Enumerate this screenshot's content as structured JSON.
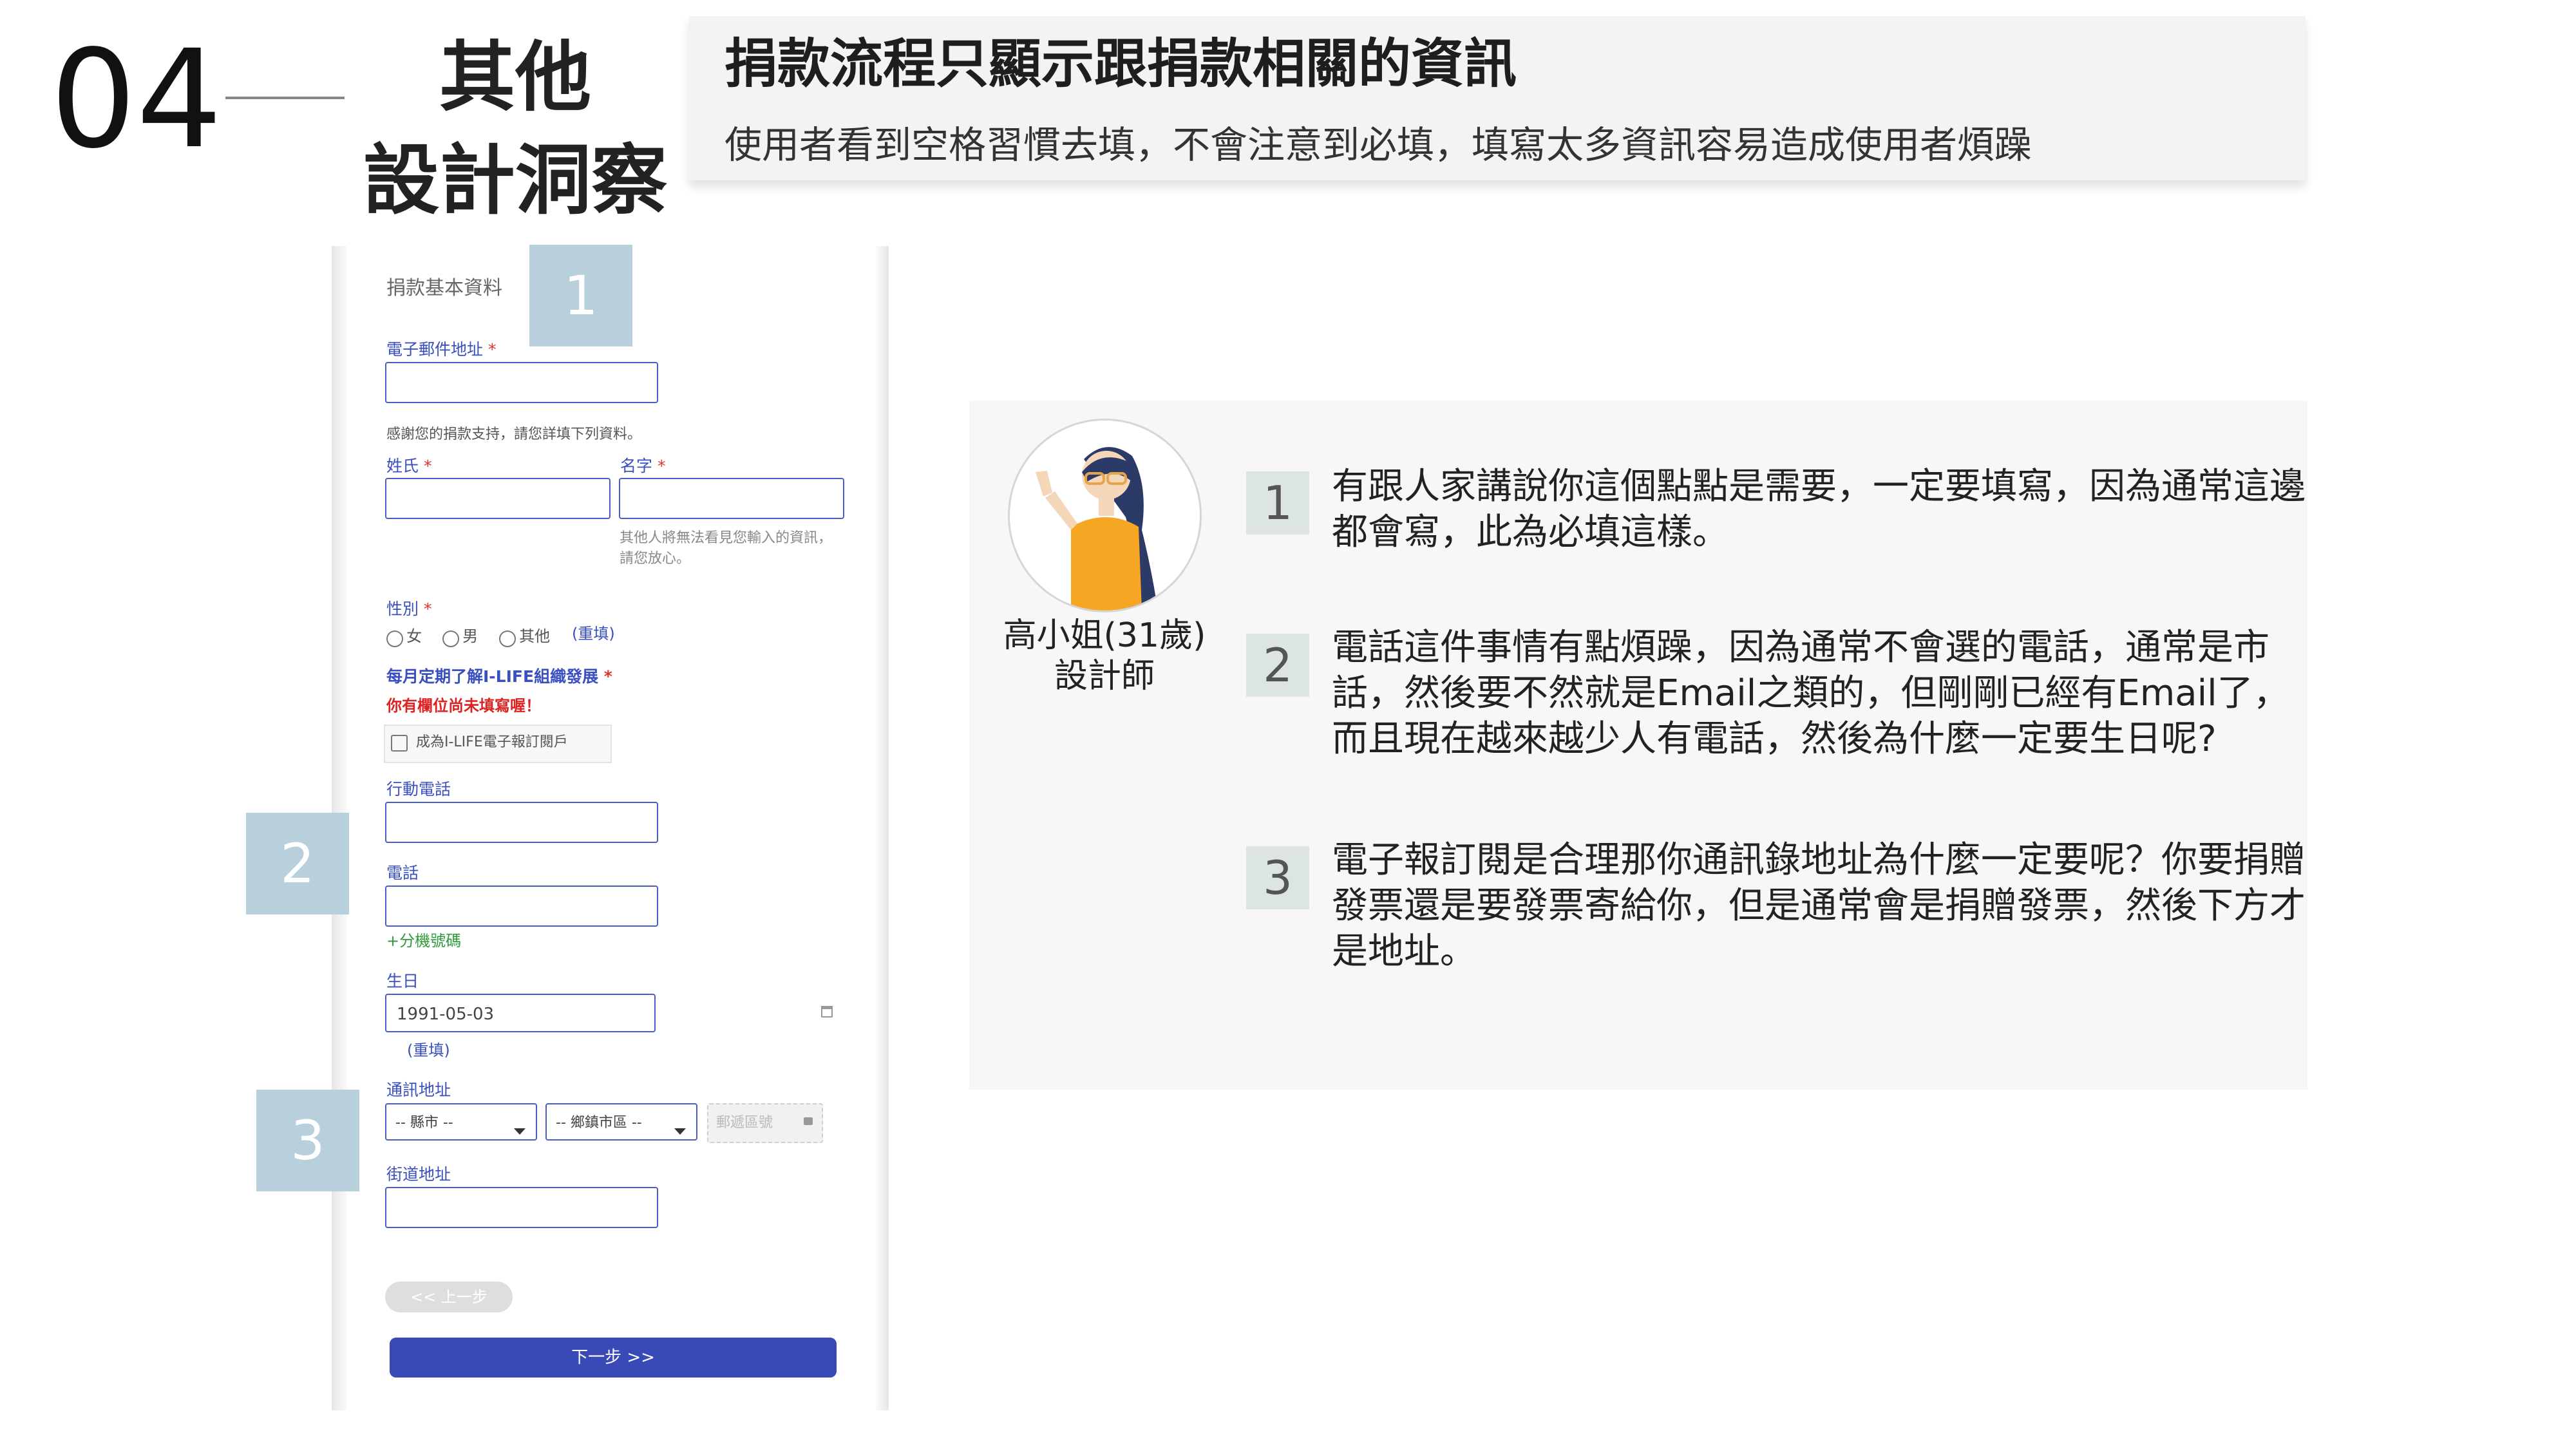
{
  "header": {
    "section_number": "04",
    "section_title_line1": "其他",
    "section_title_line2": "設計洞察",
    "banner_title": "捐款流程只顯示跟捐款相關的資訊",
    "banner_subtitle": "使用者看到空格習慣去填，不會注意到必填，填寫太多資訊容易造成使用者煩躁"
  },
  "form": {
    "section_heading": "捐款基本資料",
    "email_label": "電子郵件地址",
    "required_mark": "*",
    "thanks_text": "感謝您的捐款支持，請您詳填下列資料。",
    "last_name_label": "姓氏",
    "first_name_label": "名字",
    "name_hint_line1": "其他人將無法看見您輸入的資訊，",
    "name_hint_line2": "請您放心。",
    "gender_label": "性別",
    "gender_options": [
      "女",
      "男",
      "其他"
    ],
    "gender_reset": "(重填)",
    "newsletter_label": "每月定期了解I-LIFE組織發展",
    "newsletter_error": "你有欄位尚未填寫喔！",
    "newsletter_checkbox": "成為I-LIFE電子報訂閱戶",
    "mobile_label": "行動電話",
    "phone_label": "電話",
    "extension_link": "+分機號碼",
    "birthday_label": "生日",
    "birthday_value": "1991-05-03",
    "birthday_reset": "(重填)",
    "address_label": "通訊地址",
    "county_select": "-- 縣市 --",
    "district_select": "-- 鄉鎮市區 --",
    "postal_code_button": "郵遞區號",
    "street_label": "街道地址",
    "prev_button": "<< 上一步",
    "next_button": "下一步 >>"
  },
  "callouts": [
    "1",
    "2",
    "3"
  ],
  "persona": {
    "name": "高小姐(31歲)",
    "role": "設計師"
  },
  "insights": [
    {
      "number": "1",
      "text": "有跟人家講說你這個點點是需要，一定要填寫，因為通常這邊都會寫，此為必填這樣。"
    },
    {
      "number": "2",
      "text": "電話這件事情有點煩躁，因為通常不會選的電話，通常是市話，然後要不然就是Email之類的，但剛剛已經有Email了，而且現在越來越少人有電話，然後為什麼一定要生日呢?"
    },
    {
      "number": "3",
      "text": "電子報訂閱是合理那你通訊錄地址為什麼一定要呢？你要捐贈發票還是要發票寄給你，但是通常會是捐贈發票，然後下方才是地址。"
    }
  ],
  "colors": {
    "callout_bg": "#b8cfdc",
    "form_accent": "#3a4fc0",
    "next_button": "#3949b5",
    "badge_bg": "#dde5e3",
    "panel_bg": "#f7f7f7",
    "banner_bg": "#f3f3f3"
  }
}
